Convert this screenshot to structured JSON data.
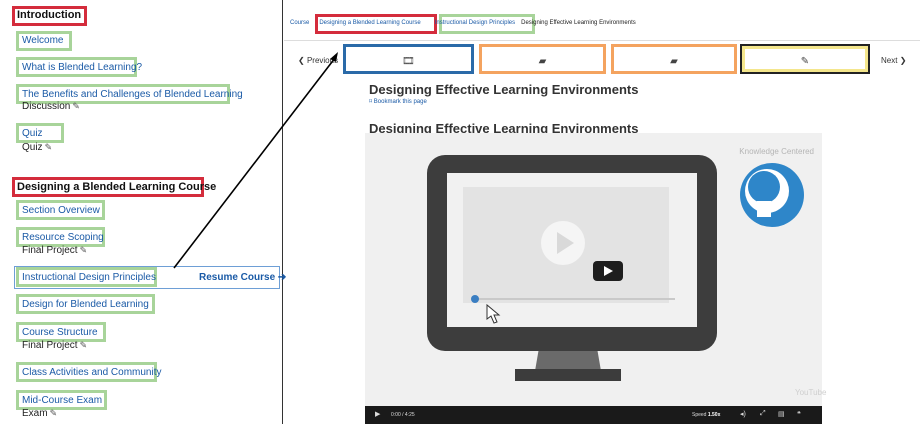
{
  "outline": {
    "sections": [
      {
        "title": "Introduction",
        "items": [
          {
            "label": "Welcome"
          },
          {
            "label": "What is Blended Learning?"
          },
          {
            "label": "The Benefits and Challenges of Blended Learning",
            "sub": "Discussion"
          },
          {
            "label": "Quiz",
            "sub": "Quiz"
          }
        ]
      },
      {
        "title": "Designing a Blended Learning Course",
        "items": [
          {
            "label": "Section Overview"
          },
          {
            "label": "Resource Scoping",
            "sub": "Final Project"
          },
          {
            "label": "Instructional Design Principles",
            "resume": "Resume Course"
          },
          {
            "label": "Design for Blended Learning"
          },
          {
            "label": "Course Structure",
            "sub": "Final Project"
          },
          {
            "label": "Class Activities and Community"
          },
          {
            "label": "Mid-Course Exam",
            "sub": "Exam"
          }
        ]
      }
    ]
  },
  "breadcrumb": [
    "Course",
    "Designing a Blended Learning Course",
    "Instructional Design Principles",
    "Designing Effective Learning Environments"
  ],
  "unit_nav": {
    "previous": "Previous",
    "next": "Next"
  },
  "page_title": "Designing Effective Learning Environments",
  "bookmark": "Bookmark this page",
  "video": {
    "heading": "Designing Effective Learning Environments",
    "watermark": "Knowledge Centered",
    "time": "0:00 / 4:25",
    "speed_label": "Speed",
    "speed_value": "1.50x",
    "brand": "YouTube"
  },
  "colors": {
    "highlight_red": "#d42c3c",
    "highlight_green": "#a8d49a",
    "highlight_blue": "#2a6aa8",
    "highlight_orange": "#f4a35f",
    "highlight_yellow": "#f4e68c",
    "link": "#1a5aa6"
  }
}
